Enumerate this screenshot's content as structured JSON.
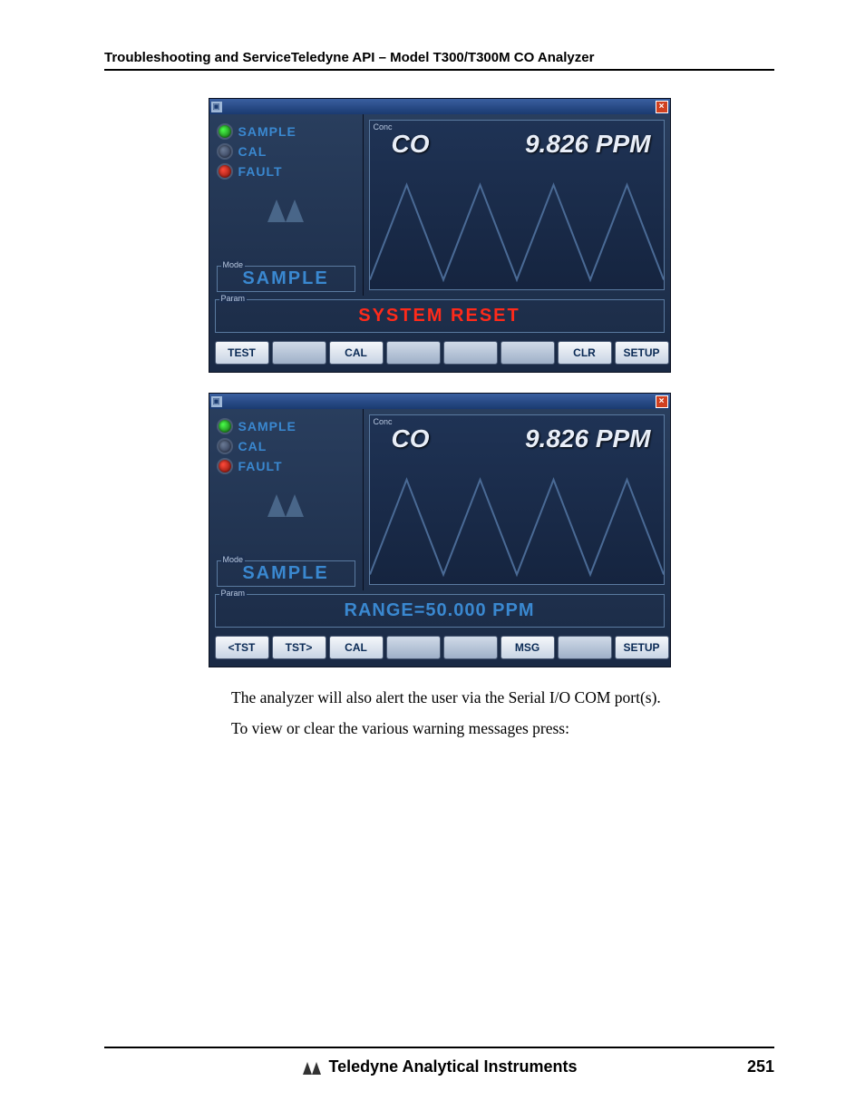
{
  "header": "Troubleshooting and ServiceTeledyne API – Model T300/T300M CO Analyzer",
  "screen1": {
    "status": [
      {
        "label": "SAMPLE",
        "led": "green"
      },
      {
        "label": "CAL",
        "led": "off"
      },
      {
        "label": "FAULT",
        "led": "red"
      }
    ],
    "mode_label": "Mode",
    "mode_value": "SAMPLE",
    "conc_label": "Conc",
    "gas": "CO",
    "reading": "9.826 PPM",
    "param_label": "Param",
    "param_value": "SYSTEM RESET",
    "buttons": [
      "TEST",
      "",
      "CAL",
      "",
      "",
      "",
      "CLR",
      "SETUP"
    ]
  },
  "screen2": {
    "status": [
      {
        "label": "SAMPLE",
        "led": "green"
      },
      {
        "label": "CAL",
        "led": "off"
      },
      {
        "label": "FAULT",
        "led": "red"
      }
    ],
    "mode_label": "Mode",
    "mode_value": "SAMPLE",
    "conc_label": "Conc",
    "gas": "CO",
    "reading": "9.826 PPM",
    "param_label": "Param",
    "param_value": "RANGE=50.000 PPM",
    "buttons": [
      "<TST",
      "TST>",
      "CAL",
      "",
      "",
      "MSG",
      "",
      "SETUP"
    ]
  },
  "body": {
    "p1": "The analyzer will also alert the user via the Serial I/O COM port(s).",
    "p2": "To view or clear the various warning messages press:"
  },
  "footer": {
    "company": "Teledyne Analytical Instruments",
    "page": "251"
  }
}
